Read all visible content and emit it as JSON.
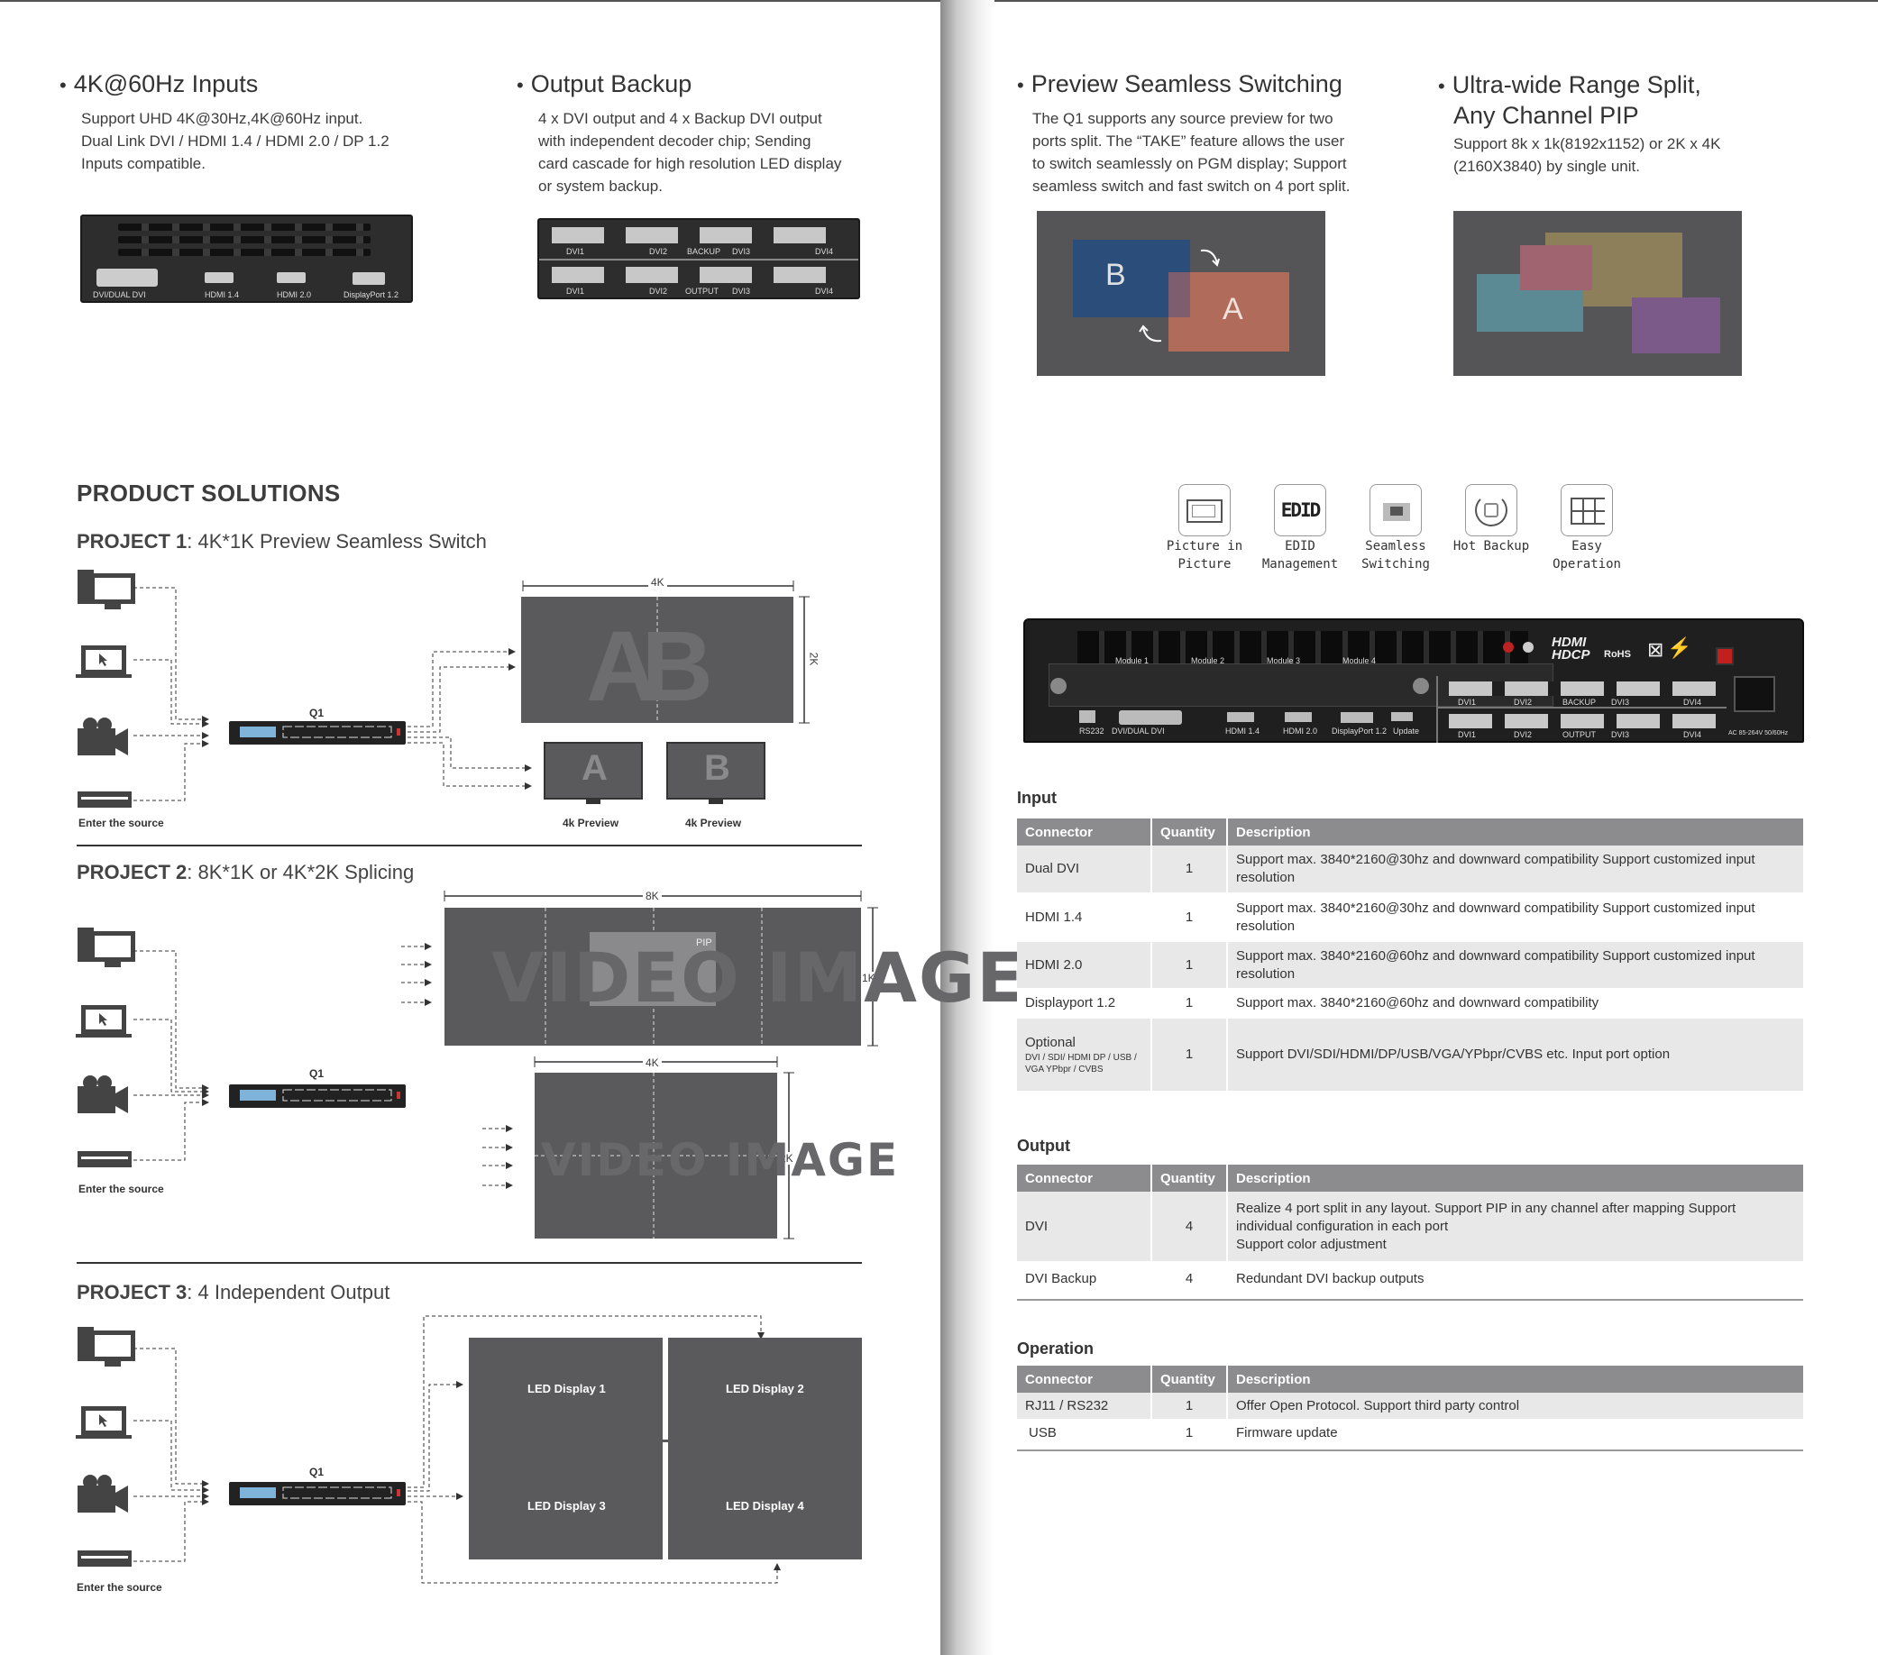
{
  "left_features": [
    {
      "title": "4K@60Hz Inputs",
      "lines": [
        "Support UHD 4K@30Hz,4K@60Hz input.",
        "Dual Link DVI / HDMI 1.4 / HDMI 2.0 / DP 1.2",
        "Inputs compatible."
      ],
      "port_labels": [
        "DVI/DUAL DVI",
        "HDMI 1.4",
        "HDMI 2.0",
        "DisplayPort 1.2"
      ]
    },
    {
      "title": "Output Backup",
      "lines": [
        "4 x DVI output and 4 x Backup DVI output",
        "with independent decoder chip; Sending",
        "card cascade for high resolution LED display",
        "or system backup."
      ],
      "top_labels": [
        "DVI1",
        "DVI2",
        "BACKUP",
        "DVI3",
        "DVI4"
      ],
      "bottom_labels": [
        "DVI1",
        "DVI2",
        "OUTPUT",
        "DVI3",
        "DVI4"
      ]
    }
  ],
  "right_features": [
    {
      "title": "Preview Seamless Switching",
      "lines": [
        "The Q1 supports any source preview for two",
        "ports split. The “TAKE” feature allows the user",
        "to switch seamlessly on PGM display; Support",
        "seamless switch and fast switch on 4 port split."
      ],
      "window_b": "B",
      "window_a": "A"
    },
    {
      "title_line1": "Ultra-wide Range Split,",
      "title_line2": "Any Channel PIP",
      "lines": [
        "Support 8k x 1k(8192x1152) or 2K x 4K",
        "(2160X3840) by single unit."
      ]
    }
  ],
  "solutions": {
    "heading": "PRODUCT SOLUTIONS",
    "source_label": "Enter the source",
    "device_label": "Q1",
    "project1": {
      "prefix": "PROJECT 1",
      "title": ": 4K*1K Preview Seamless Switch",
      "dim_w": "4K",
      "dim_h": "2K",
      "wall_text": "AB",
      "preview_a": "A",
      "preview_b": "B",
      "preview_label": "4k Preview"
    },
    "project2": {
      "prefix": "PROJECT 2",
      "title": ": 8K*1K or 4K*2K Splicing",
      "dim_w1": "8K",
      "dim_h1": "1K",
      "pip": "PIP",
      "watermark": "VIDEO IMAGE",
      "dim_w2": "4K",
      "dim_h2": "2K"
    },
    "project3": {
      "prefix": "PROJECT 3",
      "title": ": 4 Independent Output",
      "displays": [
        "LED Display 1",
        "LED Display 2",
        "LED Display 3",
        "LED Display 4"
      ]
    }
  },
  "feature_icons": [
    {
      "icon": "picture-in-picture-icon",
      "label": "Picture in Picture"
    },
    {
      "icon": "edid-icon",
      "label": "EDID Management",
      "glyph": "EDID"
    },
    {
      "icon": "seamless-switching-icon",
      "label": "Seamless Switching"
    },
    {
      "icon": "hot-backup-icon",
      "label": "Hot Backup"
    },
    {
      "icon": "easy-operation-icon",
      "label": "Easy Operation"
    }
  ],
  "rear_panel": {
    "brand_text": "HDMI",
    "hdcp_text": "HDCP",
    "rohs_text": "RoHS",
    "module_labels": [
      "Module 1",
      "Module 2",
      "Module 3",
      "Module 4"
    ],
    "bottom_labels": [
      "RS232",
      "DVI/DUAL DVI",
      "HDMI 1.4",
      "HDMI 2.0",
      "DisplayPort 1.2",
      "Update"
    ],
    "out_top": [
      "DVI1",
      "DVI2",
      "BACKUP",
      "DVI3",
      "DVI4"
    ],
    "out_bottom": [
      "DVI1",
      "DVI2",
      "OUTPUT",
      "DVI3",
      "DVI4"
    ],
    "power_label": "AC 85-264V 50/60Hz"
  },
  "tables": {
    "input": {
      "title": "Input",
      "headers": [
        "Connector",
        "Quantity",
        "Description"
      ],
      "rows": [
        {
          "connector": "Dual DVI",
          "qty": "1",
          "desc": "Support max. 3840*2160@30hz and downward compatibility  Support customized input resolution"
        },
        {
          "connector": "HDMI 1.4",
          "qty": "1",
          "desc": "Support max. 3840*2160@30hz and downward compatibility  Support customized input resolution"
        },
        {
          "connector": "HDMI 2.0",
          "qty": "1",
          "desc": "Support max. 3840*2160@60hz and downward compatibility  Support customized input resolution"
        },
        {
          "connector": "Displayport 1.2",
          "qty": "1",
          "desc": "Support max. 3840*2160@60hz and downward compatibility"
        },
        {
          "connector": "Optional",
          "connector_sub": "DVI / SDI/ HDMI  DP / USB / VGA YPbpr / CVBS",
          "qty": "1",
          "desc": "Support DVI/SDI/HDMI/DP/USB/VGA/YPbpr/CVBS etc. Input port option"
        }
      ]
    },
    "output": {
      "title": "Output",
      "headers": [
        "Connector",
        "Quantity",
        "Description"
      ],
      "rows": [
        {
          "connector": "DVI",
          "qty": "4",
          "desc": "Realize 4 port split in any layout. Support PIP in any channel after mapping  Support individual configuration in each port",
          "desc2": "Support color adjustment"
        },
        {
          "connector": "DVI Backup",
          "qty": "4",
          "desc": "Redundant DVI backup outputs"
        }
      ]
    },
    "operation": {
      "title": "Operation",
      "headers": [
        "Connector",
        "Quantity",
        "Description"
      ],
      "rows": [
        {
          "connector": "RJ11 / RS232",
          "qty": "1",
          "desc": "Offer Open Protocol. Support third party control"
        },
        {
          "connector": "USB",
          "qty": "1",
          "desc": "Firmware update"
        }
      ]
    }
  },
  "colors": {
    "display_grey": "#5a5a5c",
    "table_header": "#8c8c8e",
    "row_shade": "#e8e8e9",
    "window_blue": "#2a4d7a",
    "window_salmon": "#b06b5a",
    "split_olive": "#8c7f5a",
    "split_pink": "#a06470",
    "split_teal": "#5b8a94",
    "split_purple": "#7b5a8a"
  }
}
